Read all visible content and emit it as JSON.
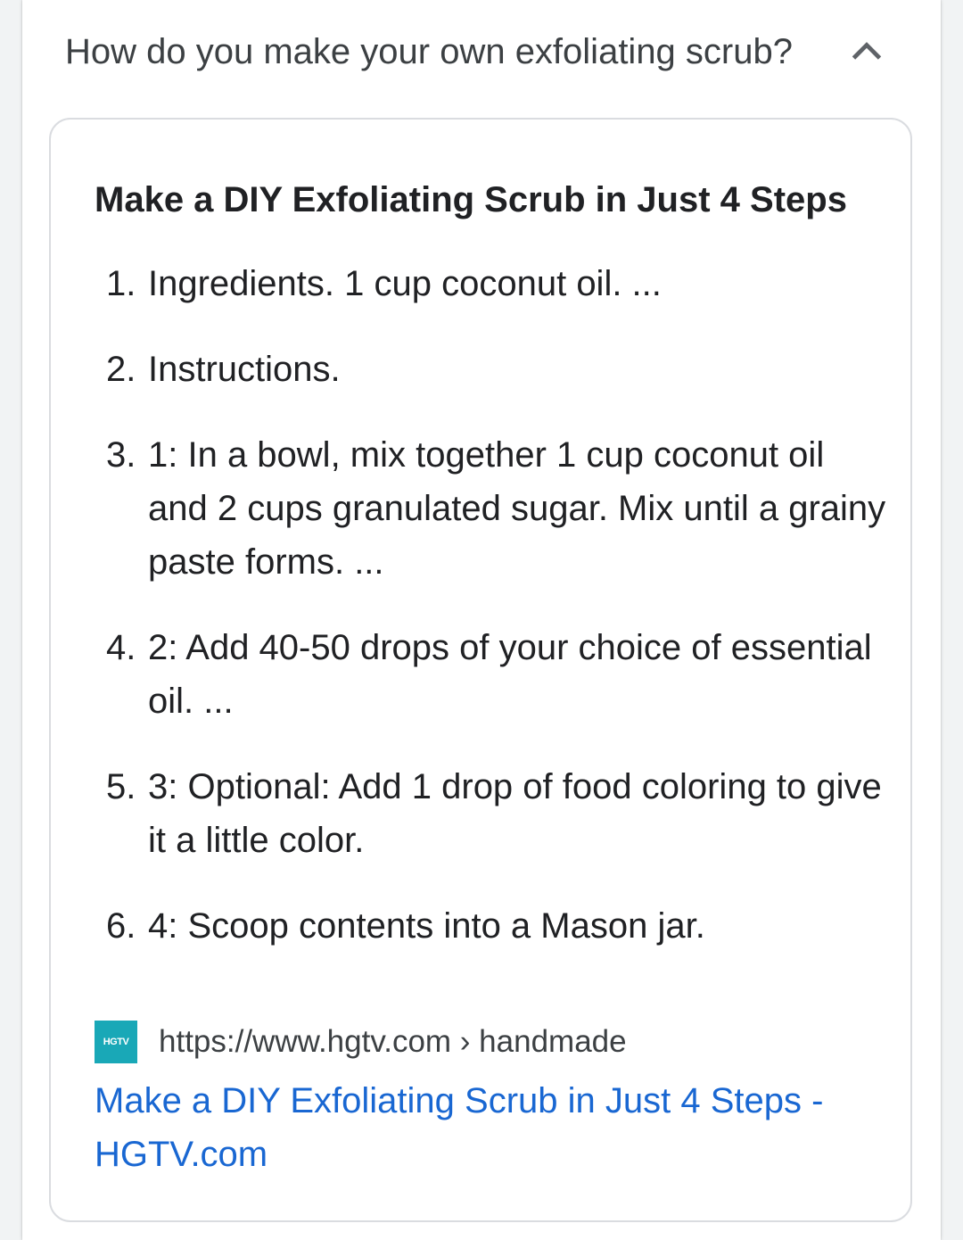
{
  "question": {
    "text": "How do you make your own exfoliating scrub?",
    "expanded_icon": "chevron-up-icon"
  },
  "snippet": {
    "title": "Make a DIY Exfoliating Scrub in Just 4 Steps",
    "steps": [
      {
        "num": "1.",
        "text": "Ingredients. 1 cup coconut oil. ..."
      },
      {
        "num": "2.",
        "text": "Instructions."
      },
      {
        "num": "3.",
        "text": "1: In a bowl, mix together 1 cup coconut oil and 2 cups granulated sugar. Mix until a grainy paste forms. ..."
      },
      {
        "num": "4.",
        "text": "2: Add 40-50 drops of your choice of essential oil. ..."
      },
      {
        "num": "5.",
        "text": "3: Optional: Add 1 drop of food coloring to give it a little color."
      },
      {
        "num": "6.",
        "text": "4: Scoop contents into a Mason jar."
      }
    ]
  },
  "source": {
    "favicon_text": "HGTV",
    "favicon_color": "#19a8b7",
    "url": "https://www.hgtv.com › handmade",
    "link_title": "Make a DIY Exfoliating Scrub in Just 4 Steps - HGTV.com",
    "link_color": "#1967d2"
  }
}
